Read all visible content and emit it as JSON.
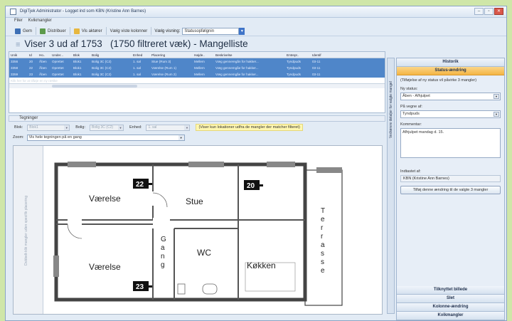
{
  "window": {
    "title": "DigiTjek Administrator - Logget ind som KBN (Kristine Ann Barnes)",
    "buttons": [
      "–",
      "▫",
      "✕"
    ]
  },
  "menu": [
    "Filer",
    "Kvikmangler"
  ],
  "toolbar": {
    "save": "Gem",
    "distribute": "Distribuer",
    "actors": "Vis aktører",
    "columns": "Vælg viste kolonner",
    "view_label": "Vælg visning:",
    "view_value": "Statusopfølgnin"
  },
  "page_title": {
    "prefix": "Viser 3 ud af 1753",
    "filtered": "(1750 filtreret væk)",
    "suffix": "- Mangelliste"
  },
  "grid": {
    "headers": [
      "Unik",
      "Id",
      "Ho..",
      "Under...",
      "Blok",
      "Bolig",
      "Enhed",
      "Placering",
      "Højde..",
      "Beskrivelse",
      "Entrepr..",
      "Identif"
    ],
    "rows": [
      [
        "3356",
        "20",
        "Åben",
        "Oprettet",
        "Blok1",
        "Bolig 3C (C2)",
        "1. sal",
        "Stue (Rum 3)",
        "Mellem",
        "Væg genneregån for hakker...",
        "Tyndpuds",
        "03-11"
      ],
      [
        "3358",
        "22",
        "Åben",
        "Oprettet",
        "Blok1",
        "Bolig 3C (C2)",
        "1. sal",
        "Værelse (Rum 1)",
        "Mellem",
        "Væg gennemgåe for hakker...",
        "Tyndpuds",
        "03-11"
      ],
      [
        "3359",
        "23",
        "Åben",
        "Oprettet",
        "Blok1",
        "Bolig 3C (C2)",
        "1. sal",
        "Værelse (Rum 2)",
        "Mellem",
        "Væg gennemgåe for hakker...",
        "Tyndpuds",
        "03-11"
      ],
      [
        "Klik her for at tilføje en ny række",
        "",
        "",
        "",
        "",
        "",
        "",
        "",
        "",
        "",
        "",
        ""
      ]
    ]
  },
  "drawings": {
    "section": "Tegninger",
    "blok_label": "Blok:",
    "blok_value": "Blok1",
    "bolig_label": "Bolig:",
    "bolig_value": "Bolig 3C (C2)",
    "enhed_label": "Enhed:",
    "enhed_value": "1. sal",
    "hint": "(Viser kun lokationer udfra de mangler der matcher filteret)",
    "zoom_label": "Zoom:",
    "zoom_value": "Vis hele tegningen på en gang",
    "side_text": "Dobbelt-klik mangler uden specifik placering",
    "rooms": {
      "r1": "Værelse",
      "r2": "Stue",
      "r3": "Værelse",
      "r4": "WC",
      "r5": "Køkken",
      "gang": [
        "G",
        "a",
        "n",
        "g"
      ],
      "terrasse": [
        "T",
        "e",
        "r",
        "r",
        "a",
        "s",
        "s",
        "e"
      ]
    },
    "markers": [
      "22",
      "20",
      "23"
    ]
  },
  "vertical_tab": "Vedrørere detaljer for valgte mangel",
  "right_panel": {
    "historik": "Historik",
    "status_header": "Status-ændring",
    "info": "(Tilføjelse af ny status vil påvirke 3 mangler)",
    "ny_status_label": "Ny status:",
    "ny_status_value": "Åben - Afhjulpet",
    "paa_vegne_label": "På vegne af:",
    "paa_vegne_value": "Tyndpuds",
    "kommentar_label": "Kommentar:",
    "kommentar_value": "Afhjulpet mandag d. 15.",
    "indtastet_label": "Indtastet af:",
    "indtastet_value": "KBN (Kristine Ann Barnes)",
    "add_button": "Tilføj denne ændring til de valgte 3 mangler",
    "footer": [
      "Tilknyttet billede",
      "Slet",
      "Kolonne-ændring",
      "Kvikmangler"
    ]
  },
  "colors": {
    "selected_row": "#4f86c9",
    "active_header": "#f4b443",
    "background": "#cfe6a8"
  }
}
